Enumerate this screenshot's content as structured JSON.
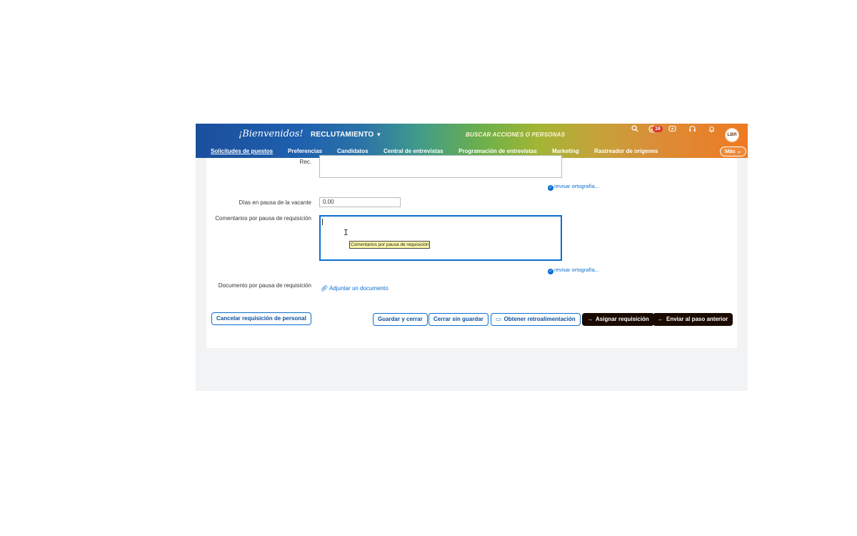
{
  "shell": {
    "logo_text": "¡Bienvenidos!",
    "module_label": "RECLUTAMIENTO",
    "search_placeholder": "BUSCAR ACCIONES O PERSONAS",
    "notification_badge": "16",
    "avatar_initials": "LBR",
    "icons": [
      "search-icon",
      "tasks-icon",
      "chat-icon",
      "help-icon",
      "bell-icon"
    ]
  },
  "nav": {
    "items": [
      {
        "label": "Solicitudes de puestos",
        "active": true
      },
      {
        "label": "Preferencias"
      },
      {
        "label": "Candidatos"
      },
      {
        "label": "Central de entrevistas"
      },
      {
        "label": "Programación de entrevistas"
      },
      {
        "label": "Marketing"
      },
      {
        "label": "Rastreador de orígenes"
      }
    ],
    "more_label": "Más"
  },
  "form": {
    "rec_label_tail": "Rec.",
    "spell_check_label": "revisar ortografía...",
    "pause_days_label": "Días en pausa de la vacante",
    "pause_days_value": "0.00",
    "pause_comments_label": "Comentarios por pausa de requisición",
    "pause_comments_tooltip": "Comentarios por pausa de requisición",
    "pause_document_label": "Documento por pausa de requisición",
    "attach_label": "Adjuntar un documento"
  },
  "actions": {
    "cancel": "Cancelar requisición de personal",
    "save_close": "Guardar y cerrar",
    "close_no_save": "Cerrar sin guardar",
    "feedback": "Obtener retroalimentación",
    "assign": "Asignar requisición",
    "send_back": "Enviar al paso anterior"
  }
}
